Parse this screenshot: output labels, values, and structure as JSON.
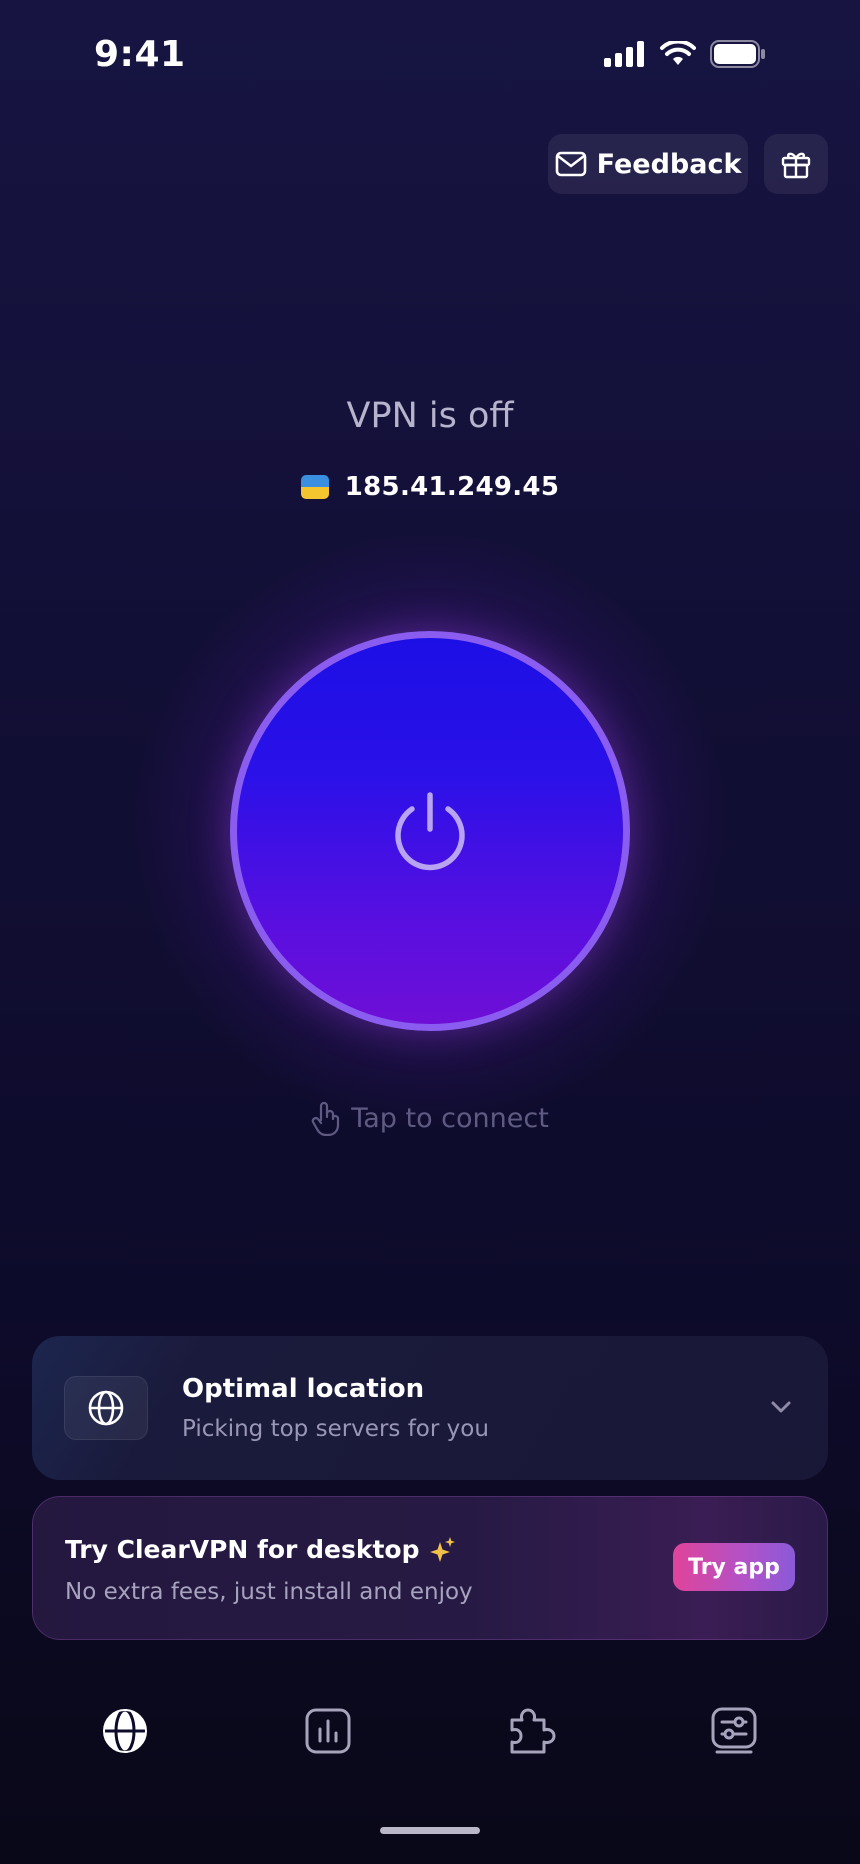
{
  "status_bar": {
    "time": "9:41"
  },
  "header": {
    "feedback_label": "Feedback"
  },
  "vpn": {
    "status": "VPN is off",
    "ip_address": "185.41.249.45",
    "tap_hint": "Tap to connect"
  },
  "location": {
    "title": "Optimal location",
    "subtitle": "Picking top servers for you"
  },
  "promo": {
    "title": "Try ClearVPN for desktop",
    "subtitle": "No extra fees, just install and enjoy",
    "button_label": "Try app"
  },
  "tabs": [
    {
      "icon": "globe-icon",
      "active": true
    },
    {
      "icon": "stats-icon",
      "active": false
    },
    {
      "icon": "puzzle-icon",
      "active": false
    },
    {
      "icon": "settings-icon",
      "active": false
    }
  ],
  "colors": {
    "background_top": "#171442",
    "background_bottom": "#090818",
    "power_button_top": "#1c0fe6",
    "power_button_bottom": "#6e0fd6",
    "power_ring": "#8a5cf0",
    "try_button_start": "#e0449a",
    "try_button_end": "#8a5ad8",
    "flag_blue": "#3b8fe0",
    "flag_yellow": "#f5c530"
  }
}
